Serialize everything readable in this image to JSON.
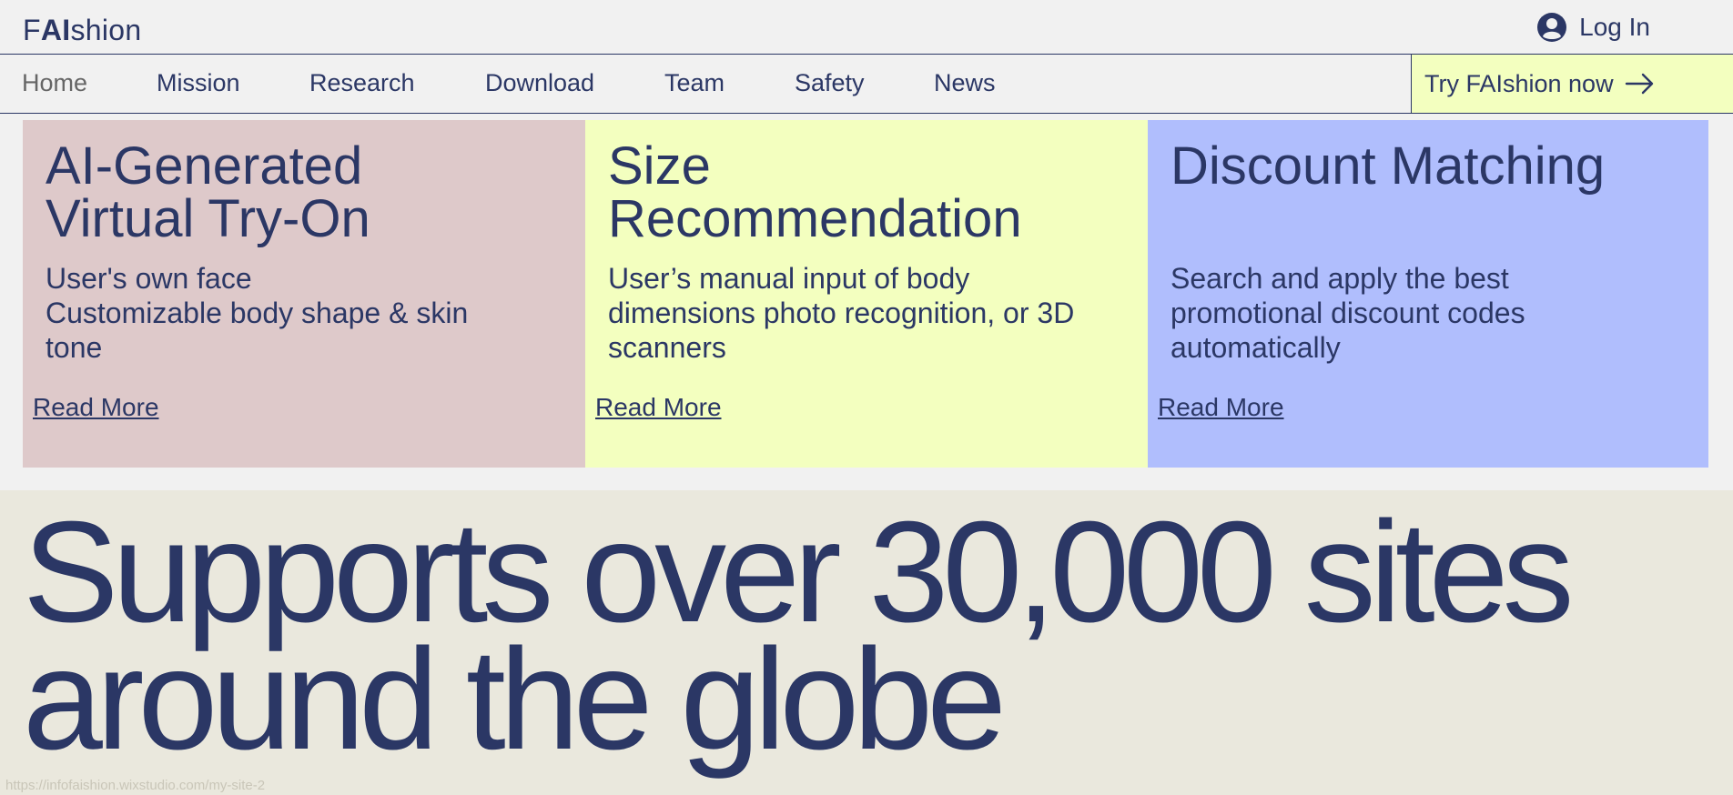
{
  "header": {
    "logo_prefix": "F",
    "logo_bold": "AI",
    "logo_suffix": "shion",
    "login_label": "Log In",
    "login_icon": "user-avatar-icon"
  },
  "nav": {
    "items": [
      "Home",
      "Mission",
      "Research",
      "Download",
      "Team",
      "Safety",
      "News"
    ],
    "active": "Home",
    "cta_label": "Try FAIshion now",
    "cta_icon": "arrow-right-icon"
  },
  "cards": [
    {
      "title_lines": [
        "AI-Generated",
        "Virtual Try-On"
      ],
      "text_lines": [
        "User's own face",
        "Customizable body shape & skin",
        "tone"
      ],
      "link": "Read More",
      "color": "#dec9ca"
    },
    {
      "title_lines": [
        "Size",
        "Recommendation"
      ],
      "text_lines": [
        "User’s manual input of body",
        "dimensions photo recognition, or 3D",
        "scanners"
      ],
      "link": "Read More",
      "color": "#f3ffbf"
    },
    {
      "title_lines": [
        "Discount Matching",
        ""
      ],
      "text_lines": [
        "Search and apply the best",
        "promotional discount codes",
        "automatically"
      ],
      "link": "Read More",
      "color": "#b0befd"
    }
  ],
  "hero": {
    "line1": "Supports over 30,000 sites",
    "line2": "around the globe"
  },
  "status_bar": {
    "url": "https://infofaishion.wixstudio.com/my-site-2"
  },
  "colors": {
    "text": "#2b3765",
    "background": "#f1f1f1",
    "hero_background": "#eae8dd"
  }
}
